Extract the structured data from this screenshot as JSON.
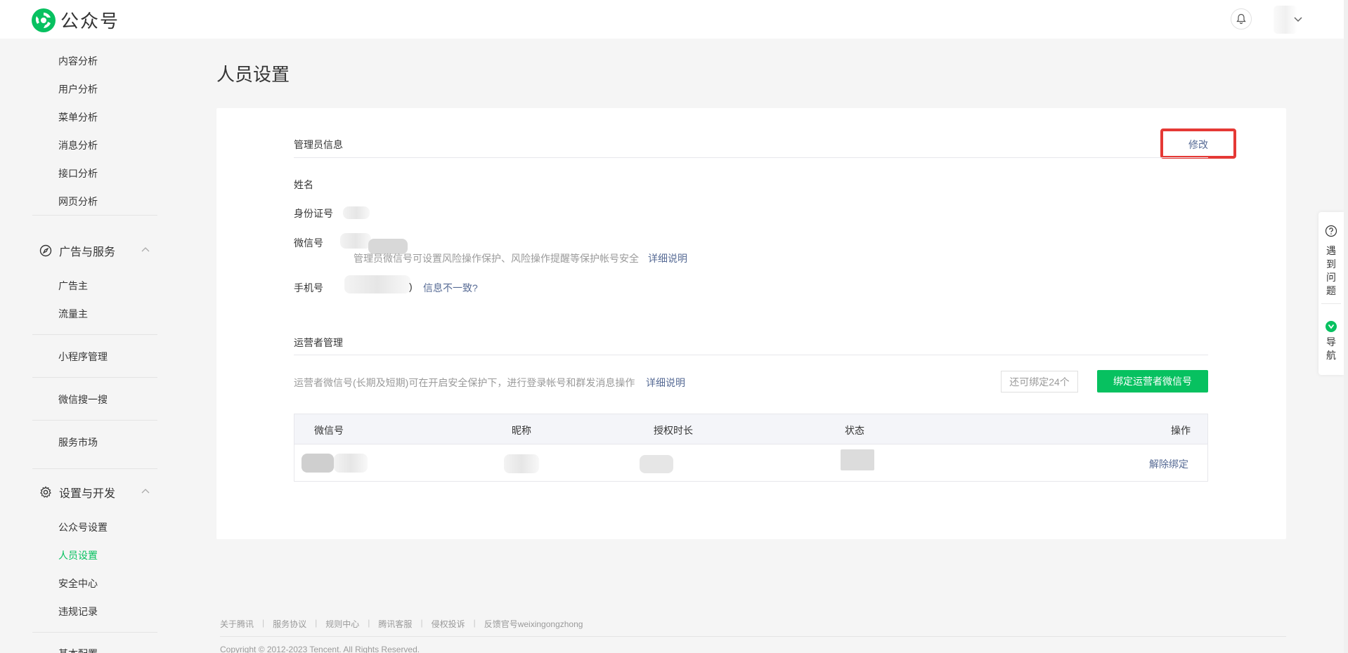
{
  "header": {
    "logo_text": "公众号"
  },
  "sidebar": {
    "analytics_items": [
      "内容分析",
      "用户分析",
      "菜单分析",
      "消息分析",
      "接口分析",
      "网页分析"
    ],
    "ads_group": "广告与服务",
    "ads_items": [
      "广告主",
      "流量主"
    ],
    "miniprogram": "小程序管理",
    "wechat_search": "微信搜一搜",
    "service_market": "服务市场",
    "settings_group": "设置与开发",
    "settings_items": [
      "公众号设置",
      "人员设置",
      "安全中心",
      "违规记录"
    ],
    "basic_config": "基本配置"
  },
  "page": {
    "title": "人员设置"
  },
  "admin": {
    "section_title": "管理员信息",
    "edit_label": "修改",
    "name_label": "姓名",
    "id_label": "身份证号",
    "wechat_label": "微信号",
    "wechat_hint": "管理员微信号可设置风险操作保护、风险操作提醒等保护帐号安全",
    "wechat_detail_link": "详细说明",
    "phone_label": "手机号",
    "phone_suffix": ")",
    "phone_mismatch_link": "信息不一致?"
  },
  "operators": {
    "section_title": "运营者管理",
    "description": "运营者微信号(长期及短期)可在开启安全保护下，进行登录帐号和群发消息操作",
    "detail_link": "详细说明",
    "quota_text": "还可绑定24个",
    "bind_button": "绑定运营者微信号",
    "columns": [
      "微信号",
      "昵称",
      "授权时长",
      "状态",
      "操作"
    ],
    "row_action": "解除绑定"
  },
  "footer": {
    "links": [
      "关于腾讯",
      "服务协议",
      "规则中心",
      "腾讯客服",
      "侵权投诉",
      "反馈官号weixingongzhong"
    ],
    "separator": "|",
    "copyright": "Copyright © 2012-2023 Tencent. All Rights Reserved."
  },
  "float_panel": {
    "help_label": "遇到问题",
    "nav_label": "导航"
  },
  "colors": {
    "brand_green": "#07c160",
    "link_blue": "#576b95",
    "highlight_red": "#e53935"
  }
}
